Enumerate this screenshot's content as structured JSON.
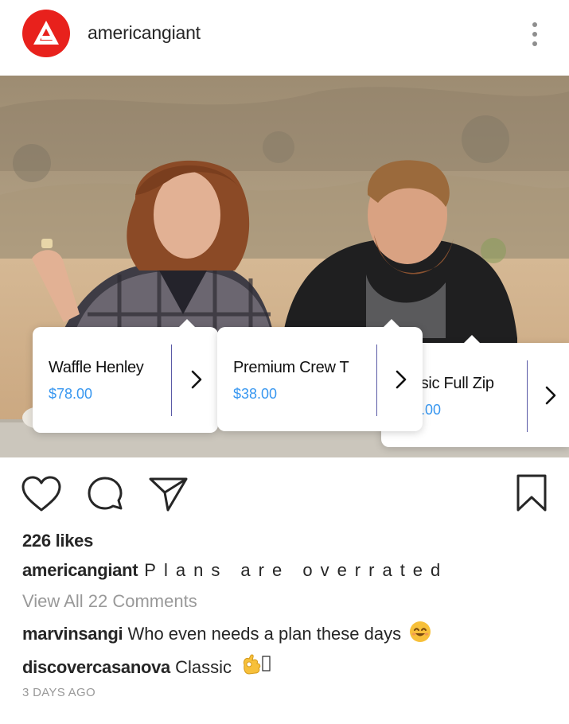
{
  "post": {
    "account": "americangiant",
    "avatar_color": "#e8211c",
    "more_icon": "three-dots-vertical-icon"
  },
  "tags": [
    {
      "name": "Waffle Henley",
      "price": "$78.00"
    },
    {
      "name": "Premium Crew T",
      "price": "$38.00"
    },
    {
      "name": "ssic Full Zip",
      "price": "8.00"
    }
  ],
  "actions": {
    "like_icon": "heart-icon",
    "comment_icon": "comment-bubble-icon",
    "share_icon": "paper-plane-icon",
    "save_icon": "bookmark-icon"
  },
  "likes": "226 likes",
  "caption": {
    "user": "americangiant",
    "text": "Plans are overrated"
  },
  "view_all": "View All 22 Comments",
  "comments": [
    {
      "user": "marvinsangi",
      "text": "Who even needs a plan these days",
      "emoji": "smiling-face-emoji"
    },
    {
      "user": "discovercasanova",
      "text": "Classic",
      "emoji": "ok-hand-emoji"
    }
  ],
  "timestamp": "3 DAYS AGO",
  "colors": {
    "link_blue": "#3897f0",
    "muted_gray": "#999999",
    "text": "#262626"
  }
}
